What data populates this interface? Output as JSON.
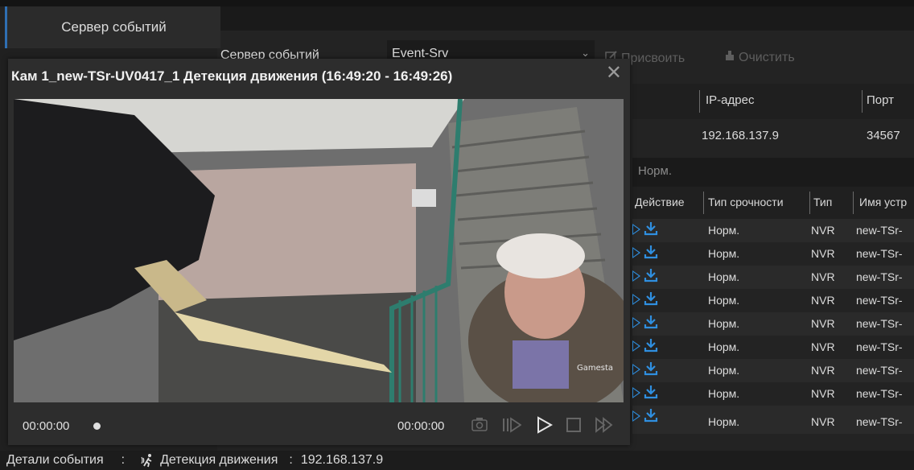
{
  "app": {
    "tab_label": "Сервер событий",
    "toolbar": {
      "server_label": "Сервер событий",
      "server_value": "Event-Srv",
      "assign_label": "Присвоить",
      "clear_label": "Очистить"
    },
    "server_table": {
      "headers": [
        "IP-адрес",
        "Порт"
      ],
      "row": {
        "ip": "192.168.137.9",
        "port": "34567"
      }
    },
    "norm_label": "Норм.",
    "events": {
      "headers": [
        "Действие",
        "Тип срочности",
        "Тип",
        "Имя устр"
      ],
      "rows": [
        {
          "urgency": "Норм.",
          "type": "NVR",
          "device": "new-TSr-"
        },
        {
          "urgency": "Норм.",
          "type": "NVR",
          "device": "new-TSr-"
        },
        {
          "urgency": "Норм.",
          "type": "NVR",
          "device": "new-TSr-"
        },
        {
          "urgency": "Норм.",
          "type": "NVR",
          "device": "new-TSr-"
        },
        {
          "urgency": "Норм.",
          "type": "NVR",
          "device": "new-TSr-"
        },
        {
          "urgency": "Норм.",
          "type": "NVR",
          "device": "new-TSr-"
        },
        {
          "urgency": "Норм.",
          "type": "NVR",
          "device": "new-TSr-"
        },
        {
          "urgency": "Норм.",
          "type": "NVR",
          "device": "new-TSr-"
        },
        {
          "urgency": "Норм.",
          "type": "NVR",
          "device": "new-TSr-"
        }
      ]
    },
    "details": {
      "label": "Детали события",
      "sep1": ":",
      "event": "Детекция движения",
      "sep2": ":",
      "ip": "192.168.137.9"
    }
  },
  "popup": {
    "title": "Кам 1_new-TSr-UV0417_1 Детекция движения (16:49:20 - 16:49:26)",
    "close_glyph": "✕",
    "time_start": "00:00:00",
    "time_end": "00:00:00",
    "progress": 0,
    "watermark": "Gamesta"
  },
  "colors": {
    "accent_blue": "#2f8fe0",
    "tab_indicator": "#2f6fb3"
  }
}
